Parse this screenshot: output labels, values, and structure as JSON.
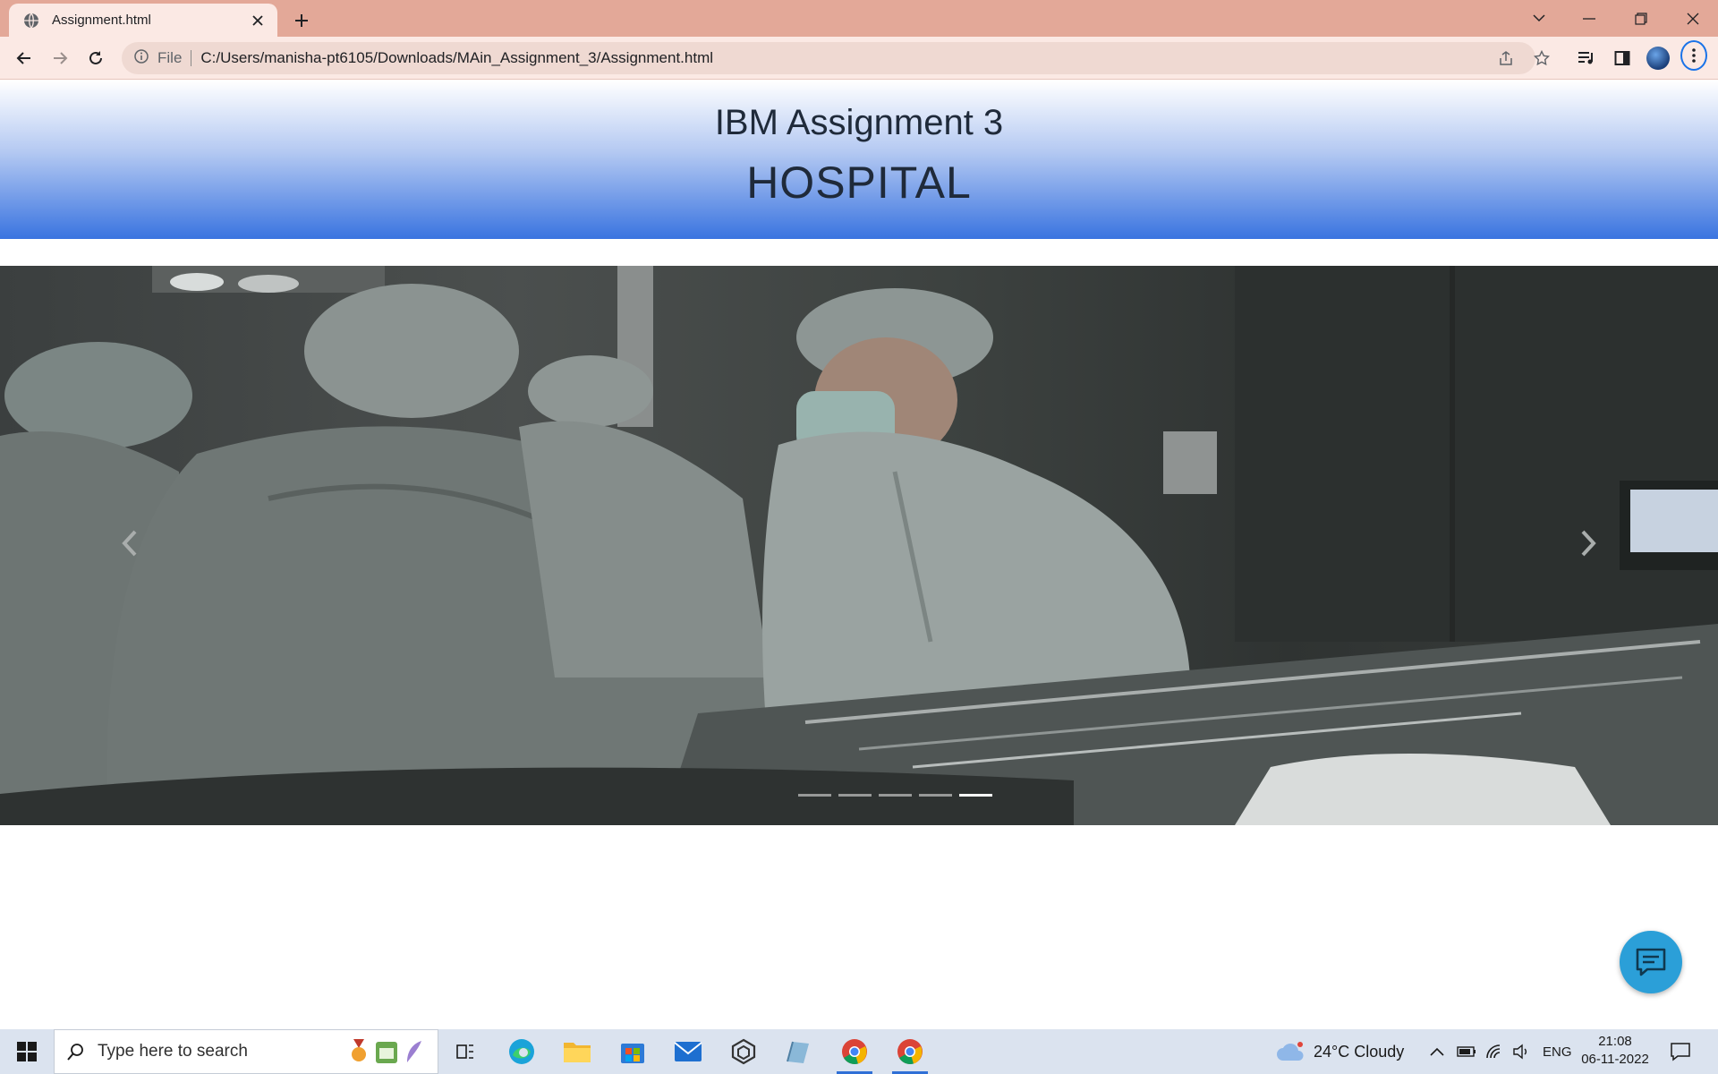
{
  "browser": {
    "tab_title": "Assignment.html",
    "url_scheme": "File",
    "url": "C:/Users/manisha-pt6105/Downloads/MAin_Assignment_3/Assignment.html",
    "accent": "#1a73e8",
    "tabbar_color": "#e3a898"
  },
  "header": {
    "line1": "IBM Assignment 3",
    "line2": "HOSPITAL"
  },
  "carousel": {
    "indicator_count": 5,
    "active_index": 4,
    "image_alt": "surgeons in operating room"
  },
  "taskbar": {
    "search_placeholder": "Type here to search",
    "apps": [
      "task-view",
      "edge",
      "file-explorer",
      "microsoft-store",
      "mail",
      "dev-tool",
      "sketch-app",
      "chrome",
      "chrome"
    ],
    "weather": "24°C  Cloudy",
    "language": "ENG",
    "time": "21:08",
    "date": "06-11-2022"
  }
}
